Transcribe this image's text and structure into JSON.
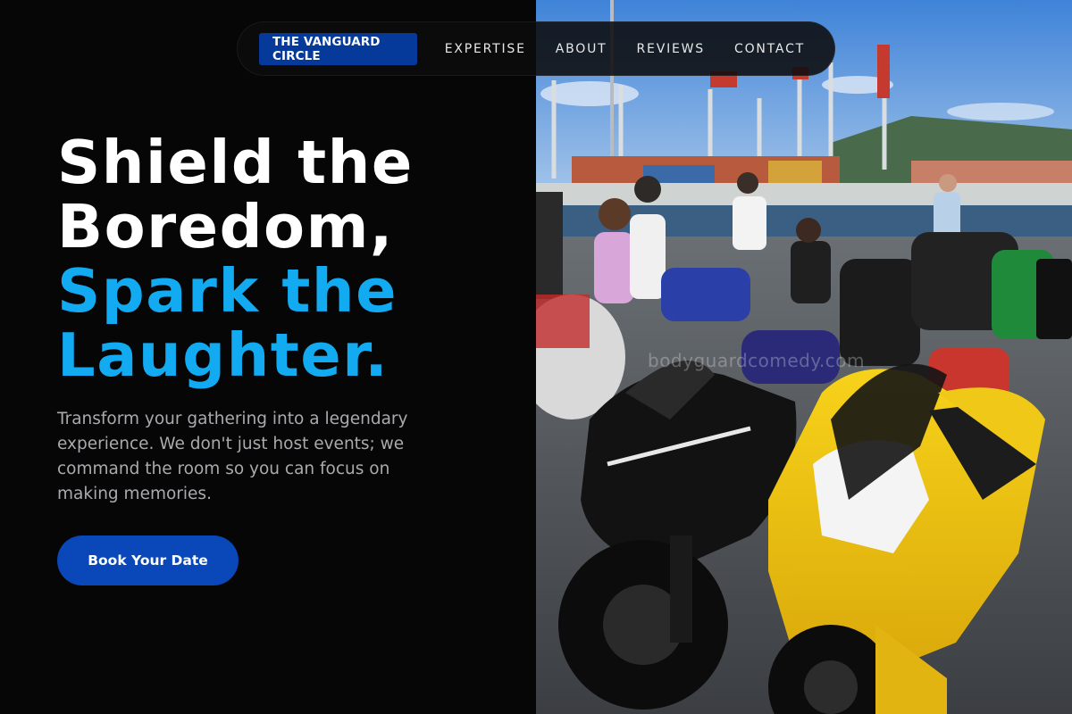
{
  "nav": {
    "brand": "THE VANGUARD CIRCLE",
    "links": [
      "EXPERTISE",
      "ABOUT",
      "REVIEWS",
      "CONTACT"
    ]
  },
  "hero": {
    "headline_line1": "Shield the",
    "headline_line2": "Boredom,",
    "headline_line3": "Spark the",
    "headline_line4": "Laughter.",
    "description": "Transform your gathering into a legendary experience. We don't just host events; we command the room so you can focus on making memories.",
    "cta_label": "Book Your Date"
  },
  "photo": {
    "subject": "motorcycles-at-harbor-photo",
    "watermark": "bodyguardcomedy.com"
  },
  "colors": {
    "background": "#060606",
    "accent_blue": "#12aaf0",
    "brand_blue": "#063a9a",
    "cta_blue": "#0a47b8",
    "body_text": "#a9aaae"
  }
}
